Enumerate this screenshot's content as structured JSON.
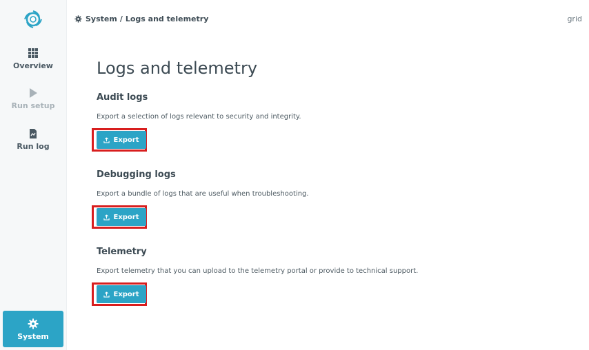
{
  "sidebar": {
    "items": [
      {
        "label": "Overview",
        "icon": "grid-icon"
      },
      {
        "label": "Run setup",
        "icon": "play-icon",
        "disabled": true
      },
      {
        "label": "Run log",
        "icon": "document-icon"
      },
      {
        "label": "System",
        "icon": "gear-icon",
        "active": true
      }
    ],
    "logo_icon": "spiral-logo-icon"
  },
  "header": {
    "breadcrumb_root": "System",
    "breadcrumb_separator": "/",
    "breadcrumb_current": "Logs and telemetry",
    "right_text": "grid"
  },
  "main": {
    "title": "Logs and telemetry",
    "sections": [
      {
        "title": "Audit logs",
        "description": "Export a selection of logs relevant to security and integrity.",
        "button_label": "Export"
      },
      {
        "title": "Debugging logs",
        "description": "Export a bundle of logs that are useful when troubleshooting.",
        "button_label": "Export"
      },
      {
        "title": "Telemetry",
        "description": "Export telemetry that you can upload to the telemetry portal or provide to technical support.",
        "button_label": "Export"
      }
    ]
  },
  "colors": {
    "accent": "#2ca4c6",
    "highlight": "#d81e1e",
    "sidebar_bg": "#f6f8f9",
    "text": "#3c4a53"
  }
}
